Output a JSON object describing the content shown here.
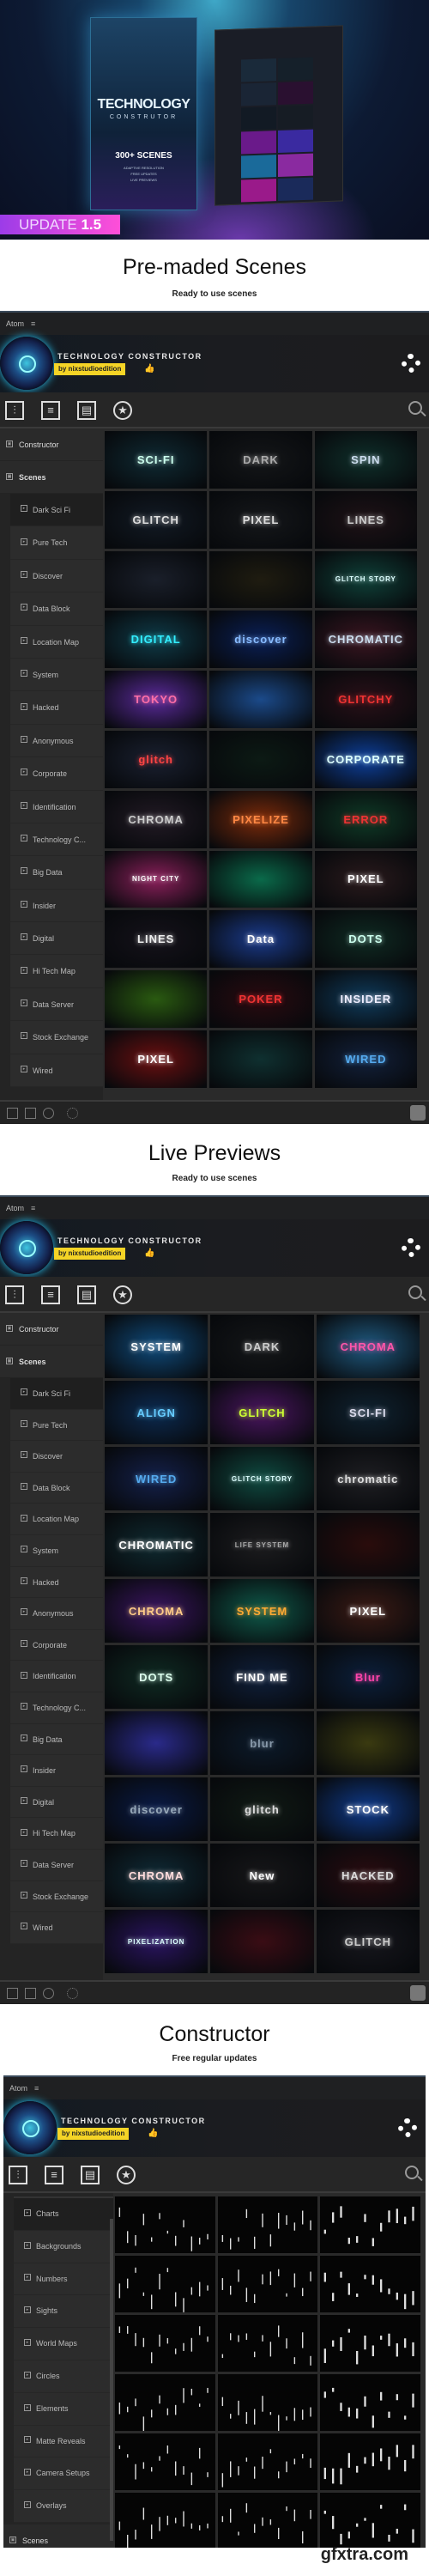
{
  "hero": {
    "product_title": "TECHNOLOGY",
    "product_subtitle": "CONSTRUTOR",
    "scenes_count": "300+ SCENES",
    "features": [
      "ADAPTIVE RESOLUTION",
      "FREE UPDATES",
      "LIVE PREVIEWS"
    ],
    "update_label": "UPDATE",
    "update_version": "1.5"
  },
  "panel_common": {
    "app_name": "Atom",
    "menu_icon": "hamburger-icon",
    "plugin_title": "TECHNOLOGY CONSTRUCTOR",
    "author_badge": "by nixstudioedition",
    "thumb_icon": "👍",
    "toolbar_icons": [
      "sliders-icon",
      "list-icon",
      "document-icon",
      "star-icon"
    ],
    "toolbar_glyphs": [
      "⫶",
      "≡",
      "▤",
      "★"
    ],
    "bottom_icons": [
      "panel-icon",
      "grid-icon",
      "play-icon",
      "gear-icon",
      "atom-logo-icon"
    ]
  },
  "colors": {
    "accent_yellow": "#f5d426",
    "panel_bg": "#262626",
    "update_pink": "#ff4fd8"
  },
  "sections": [
    {
      "title": "Pre-maded Scenes",
      "subtitle": "Ready to use scenes",
      "panel": {
        "top_items": [
          "Constructor",
          "Scenes"
        ],
        "sub_items": [
          "Dark Sci Fi",
          "Pure Tech",
          "Discover",
          "Data Block",
          "Location Map",
          "System",
          "Hacked",
          "Anonymous",
          "Corporate",
          "Identification",
          "Technology C...",
          "Big Data",
          "Insider",
          "Digital",
          "Hi Tech Map",
          "Data Server",
          "Stock Exchange",
          "Wired"
        ],
        "selected": "Dark Sci Fi",
        "tiles": [
          [
            "SCI-FI",
            "#0f2a33",
            "#cfe"
          ],
          [
            "DARK",
            "#141618",
            "#aaa"
          ],
          [
            "SPIN",
            "#0f2f2a",
            "#cde"
          ],
          [
            "GLITCH",
            "#121a24",
            "#ddd"
          ],
          [
            "PIXEL",
            "#15171a",
            "#ddd"
          ],
          [
            "LINES",
            "#1e1216",
            "#ccc"
          ],
          [
            "",
            "#1a1f2a",
            "#ddd"
          ],
          [
            "",
            "#1f1c10",
            "#ee3"
          ],
          [
            "GLITCH STORY",
            "#0f4038",
            "#dff"
          ],
          [
            "DIGITAL",
            "#0f3b48",
            "#3ef"
          ],
          [
            "discover",
            "#0a1f55",
            "#8bf"
          ],
          [
            "CHROMATIC",
            "#3a1520",
            "#cde"
          ],
          [
            "TOKYO",
            "#5a2a9a",
            "#ff6fa8"
          ],
          [
            "",
            "#1b4a8a",
            "#cef"
          ],
          [
            "GLITCHY",
            "#2a1018",
            "#e33"
          ],
          [
            "glitch",
            "#1a2030",
            "#f44"
          ],
          [
            "",
            "#0c1a14",
            "#4e8"
          ],
          [
            "CORPORATE",
            "#0d3f9a",
            "#dff"
          ],
          [
            "CHROMA",
            "#221a24",
            "#ccc"
          ],
          [
            "PIXELIZE",
            "#7a2a0a",
            "#f84"
          ],
          [
            "ERROR",
            "#0f3a26",
            "#e33"
          ],
          [
            "NIGHT CITY",
            "#8a1f5a",
            "#fff"
          ],
          [
            "",
            "#0a6a4a",
            "#ddd"
          ],
          [
            "PIXEL",
            "#2a1a1c",
            "#fff"
          ],
          [
            "LINES",
            "#15121a",
            "#eee"
          ],
          [
            "Data",
            "#1a3a8a",
            "#fff"
          ],
          [
            "DOTS",
            "#0f2a22",
            "#cfe"
          ],
          [
            "",
            "#2a5a10",
            "#fff"
          ],
          [
            "POKER",
            "#2a0a10",
            "#e33"
          ],
          [
            "INSIDER",
            "#0f3a5a",
            "#eef"
          ],
          [
            "PIXEL",
            "#6a0f10",
            "#fff"
          ],
          [
            "",
            "#0f3030",
            "#ddd"
          ],
          [
            "WIRED",
            "#12203a",
            "#5ae"
          ]
        ]
      }
    },
    {
      "title": "Live Previews",
      "subtitle": "Ready to use scenes",
      "panel": {
        "top_items": [
          "Constructor",
          "Scenes"
        ],
        "sub_items": [
          "Dark Sci Fi",
          "Pure Tech",
          "Discover",
          "Data Block",
          "Location Map",
          "System",
          "Hacked",
          "Anonymous",
          "Corporate",
          "Identification",
          "Technology C...",
          "Big Data",
          "Insider",
          "Digital",
          "Hi Tech Map",
          "Data Server",
          "Stock Exchange",
          "Wired"
        ],
        "selected": "Dark Sci Fi",
        "tiles": [
          [
            "SYSTEM",
            "#0f4a7a",
            "#fff"
          ],
          [
            "DARK",
            "#141618",
            "#ccc"
          ],
          [
            "CHROMA",
            "#1f5a80",
            "#f5a"
          ],
          [
            "ALIGN",
            "#0c2a50",
            "#6cf"
          ],
          [
            "GLITCH",
            "#4a1560",
            "#cf3"
          ],
          [
            "SCI-FI",
            "#0f2230",
            "#dde"
          ],
          [
            "WIRED",
            "#14204a",
            "#5ae"
          ],
          [
            "GLITCH STORY",
            "#0f4a40",
            "#dff"
          ],
          [
            "chromatic",
            "#1e1e22",
            "#ddd"
          ],
          [
            "CHROMATIC",
            "#0f2a30",
            "#fff"
          ],
          [
            "LIFE SYSTEM",
            "#1c1c1e",
            "#aaa"
          ],
          [
            "",
            "#2a0c0c",
            "#e33"
          ],
          [
            "CHROMA",
            "#3a1560",
            "#fc8"
          ],
          [
            "SYSTEM",
            "#0f5a4a",
            "#fa3"
          ],
          [
            "PIXEL",
            "#3a1a14",
            "#fff"
          ],
          [
            "DOTS",
            "#0f2a22",
            "#dfe"
          ],
          [
            "FIND ME",
            "#0f1f3a",
            "#fff"
          ],
          [
            "Blur",
            "#0c1f3a",
            "#f4a"
          ],
          [
            "",
            "#2a2a8a",
            "#f55"
          ],
          [
            "blur",
            "#0c1a2a",
            "#89a"
          ],
          [
            "",
            "#3a3a10",
            "#fff"
          ],
          [
            "discover",
            "#0a1a45",
            "#9ab"
          ],
          [
            "glitch",
            "#101a14",
            "#ddd"
          ],
          [
            "STOCK",
            "#0f3a8a",
            "#fff"
          ],
          [
            "CHROMA",
            "#0f2a35",
            "#fdd"
          ],
          [
            "New",
            "#161618",
            "#fff"
          ],
          [
            "HACKED",
            "#2a0c10",
            "#ddd"
          ],
          [
            "PIXELIZATION",
            "#2a1460",
            "#dff"
          ],
          [
            "",
            "#3a0c14",
            "#fff"
          ],
          [
            "GLITCH",
            "#16161c",
            "#ccc"
          ]
        ]
      }
    },
    {
      "title": "Constructor",
      "subtitle": "Free regular updates",
      "panel": {
        "top_items": [],
        "sub_items": [
          "Charts",
          "Backgrounds",
          "Numbers",
          "Sights",
          "World Maps",
          "Circles",
          "Elements",
          "Matte Reveals",
          "Camera Setups",
          "Overlays"
        ],
        "bottom_items": [
          "Scenes"
        ],
        "selected": "Charts",
        "tiles": [
          [
            "",
            "#000",
            "#fff"
          ],
          [
            "",
            "#000",
            "#fff"
          ],
          [
            "",
            "#000",
            "#fff"
          ],
          [
            "",
            "#000",
            "#fff"
          ],
          [
            "",
            "#000",
            "#fff"
          ],
          [
            "",
            "#000",
            "#fff"
          ],
          [
            "",
            "#000",
            "#fff"
          ],
          [
            "",
            "#000",
            "#fff"
          ],
          [
            "",
            "#000",
            "#fff"
          ],
          [
            "",
            "#000",
            "#fff"
          ],
          [
            "",
            "#000",
            "#fff"
          ],
          [
            "",
            "#000",
            "#fff"
          ],
          [
            "",
            "#000",
            "#fff"
          ],
          [
            "",
            "#000",
            "#fff"
          ],
          [
            "",
            "#000",
            "#fff"
          ],
          [
            "",
            "#000",
            "#fff"
          ],
          [
            "",
            "#000",
            "#fff"
          ],
          [
            "",
            "#000",
            "#fff"
          ]
        ]
      }
    }
  ],
  "watermark": "gfxtra.com"
}
